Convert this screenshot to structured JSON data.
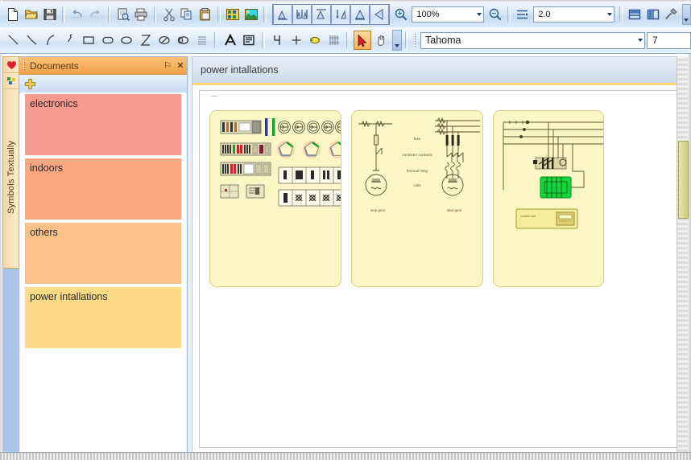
{
  "toolbars": {
    "row1": [
      {
        "name": "new-document",
        "label": "New"
      },
      {
        "name": "open-document",
        "label": "Open"
      },
      {
        "name": "save-document",
        "label": "Save"
      },
      {
        "name": "undo",
        "label": "Undo"
      },
      {
        "name": "redo",
        "label": "Redo"
      },
      {
        "name": "print-preview",
        "label": "Print Preview"
      },
      {
        "name": "print",
        "label": "Print"
      },
      {
        "name": "cut",
        "label": "Cut"
      },
      {
        "name": "copy",
        "label": "Copy"
      },
      {
        "name": "paste",
        "label": "Paste"
      },
      {
        "name": "insert-symbol",
        "label": "Insert Symbol"
      },
      {
        "name": "insert-image",
        "label": "Insert Image"
      }
    ],
    "align_group": [
      {
        "name": "align-left",
        "label": "Align Left"
      },
      {
        "name": "align-center-horizontal",
        "label": "Align Center"
      },
      {
        "name": "align-right",
        "label": "Align Right"
      },
      {
        "name": "distribute-vertical",
        "label": "Distribute Vertically"
      },
      {
        "name": "align-top",
        "label": "Align Top"
      },
      {
        "name": "align-bottom",
        "label": "Align Bottom"
      }
    ],
    "zoom": {
      "zoom_in_label": "Zoom In",
      "zoom_out_label": "Zoom Out",
      "value": "100%"
    },
    "scale": {
      "icon_label": "Line Spacing",
      "value": "2.0"
    },
    "view_buttons": [
      {
        "name": "split-horizontal",
        "label": "Split Horizontal"
      },
      {
        "name": "split-vertical",
        "label": "Split Vertical"
      },
      {
        "name": "tools",
        "label": "Tools"
      }
    ],
    "row2": [
      {
        "name": "line-tool",
        "label": "Line"
      },
      {
        "name": "polyline-tool",
        "label": "Polyline"
      },
      {
        "name": "arc-tool",
        "label": "Arc"
      },
      {
        "name": "bezier-tool",
        "label": "Bezier"
      },
      {
        "name": "rectangle-tool",
        "label": "Rectangle"
      },
      {
        "name": "rounded-rectangle-tool",
        "label": "Rounded Rectangle"
      },
      {
        "name": "ellipse-tool",
        "label": "Ellipse"
      },
      {
        "name": "hourglass-tool",
        "label": "Hourglass"
      },
      {
        "name": "pie-tool",
        "label": "Pie"
      },
      {
        "name": "chord-tool",
        "label": "Chord"
      },
      {
        "name": "list-tool",
        "label": "List"
      }
    ],
    "row2b": [
      {
        "name": "text-tool",
        "label": "Text"
      },
      {
        "name": "text-block-tool",
        "label": "Text Block"
      },
      {
        "name": "dimension-tool",
        "label": "Dimension"
      },
      {
        "name": "crosshair-tool",
        "label": "Point"
      },
      {
        "name": "highlight-tool",
        "label": "Highlight"
      },
      {
        "name": "hatch-tool",
        "label": "Hatch"
      }
    ],
    "row2c": [
      {
        "name": "select-arrow-tool",
        "label": "Select",
        "active": true
      },
      {
        "name": "pan-hand-tool",
        "label": "Pan",
        "active": false
      }
    ],
    "font": {
      "family": "Tahoma",
      "size": "7"
    }
  },
  "vertical_tab": {
    "label": "Symbols Textually",
    "icons": [
      "heart-icon",
      "symbols-icon"
    ]
  },
  "panel": {
    "title": "Documents",
    "pin_label": "⚐",
    "close_label": "✕",
    "add_label": "+",
    "items": [
      {
        "label": "electronics",
        "color": "#f79a90"
      },
      {
        "label": "indoors",
        "color": "#fba781"
      },
      {
        "label": "others",
        "color": "#fcc189"
      },
      {
        "label": "power intallations",
        "color": "#fddb86"
      }
    ]
  },
  "main": {
    "title": "power intallations",
    "documents": [
      {
        "name": "symbol-library-thumbnail"
      },
      {
        "name": "motor-control-schematic-thumbnail",
        "labels": [
          "fuse",
          "contactor contacts",
          "thermal relay",
          "coils",
          "stop gear",
          "start gear"
        ]
      },
      {
        "name": "power-panel-schematic-thumbnail"
      }
    ]
  },
  "colors": {
    "panel_header": "#f2a14c",
    "accent_yellow": "#ffd971",
    "thumb_bg": "#fbf6c6",
    "toolbar_blue": "#c7dcf2"
  }
}
